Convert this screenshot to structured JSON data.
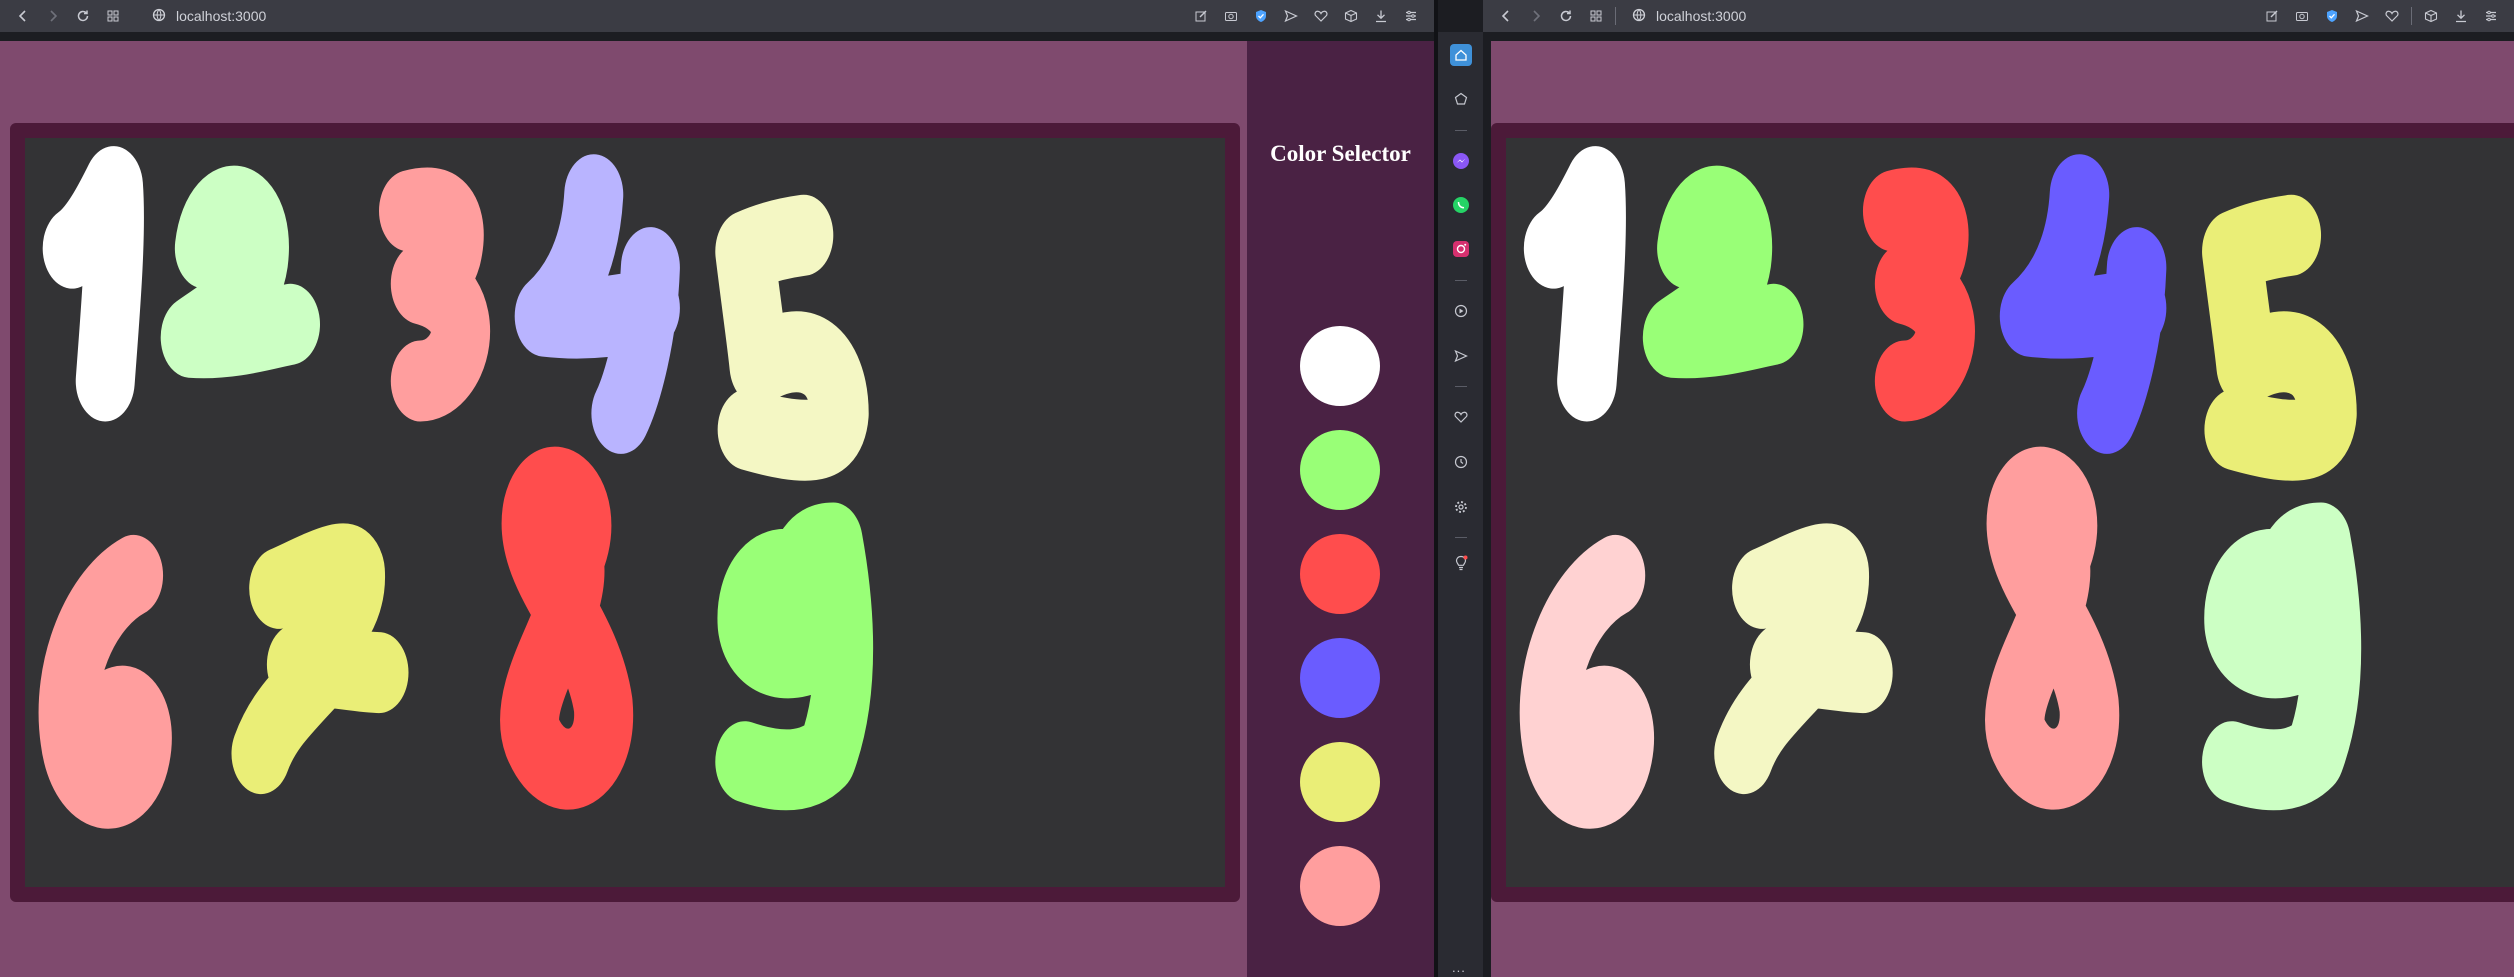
{
  "left_browser": {
    "url": "localhost:3000"
  },
  "right_browser": {
    "url": "localhost:3000"
  },
  "icons": {
    "back": "arrow-left-icon",
    "forward": "arrow-right-icon",
    "reload": "reload-icon",
    "tabs": "grid-icon",
    "site": "globe-icon",
    "edit": "edit-icon",
    "camera": "camera-icon",
    "shield": "shield-icon",
    "send": "send-icon",
    "heart": "heart-icon",
    "box": "box-icon",
    "download": "download-icon",
    "menu": "menu-icon"
  },
  "color_selector": {
    "title": "Color Selector",
    "colors": [
      "#ffffff",
      "#99ff77",
      "#ff4d4d",
      "#6a5cff",
      "#eaee77",
      "#ff9e9e"
    ]
  },
  "sidebar_icons": [
    "home-icon",
    "pentagon-icon",
    "messenger-icon",
    "whatsapp-icon",
    "instagram-icon",
    "play-icon",
    "send-icon",
    "heart-icon",
    "clock-icon",
    "settings-icon",
    "bulb-icon"
  ],
  "sidebar_more": "...",
  "left_digits": [
    {
      "digit": "1",
      "color": "#ffffff"
    },
    {
      "digit": "2",
      "color": "#ccffc4"
    },
    {
      "digit": "3",
      "color": "#ff9e9e"
    },
    {
      "digit": "4",
      "color": "#b9b4ff"
    },
    {
      "digit": "5",
      "color": "#f4f7c4"
    },
    {
      "digit": "6",
      "color": "#ff9e9e"
    },
    {
      "digit": "7",
      "color": "#eaee77"
    },
    {
      "digit": "8",
      "color": "#ff4d4d"
    },
    {
      "digit": "9",
      "color": "#99ff77"
    }
  ],
  "right_digits": [
    {
      "digit": "1",
      "color": "#ffffff"
    },
    {
      "digit": "2",
      "color": "#99ff77"
    },
    {
      "digit": "3",
      "color": "#ff4d4d"
    },
    {
      "digit": "4",
      "color": "#6a5cff"
    },
    {
      "digit": "5",
      "color": "#eaee77"
    },
    {
      "digit": "6",
      "color": "#ffd2d2"
    },
    {
      "digit": "7",
      "color": "#f4f7c4"
    },
    {
      "digit": "8",
      "color": "#ff9e9e"
    },
    {
      "digit": "9",
      "color": "#ccffc4"
    }
  ]
}
